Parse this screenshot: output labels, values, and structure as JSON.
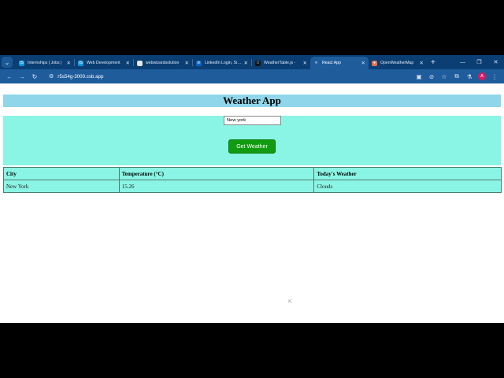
{
  "browser": {
    "tabs": [
      {
        "title": "Internships | Jobs |",
        "icon": "internshala-icon",
        "color": "#1295d8",
        "glyph": "IS"
      },
      {
        "title": "Web Development",
        "icon": "internshala-icon",
        "color": "#1295d8",
        "glyph": "IS"
      },
      {
        "title": "webwizardsolution",
        "icon": "globe-icon",
        "color": "#e0e0e0",
        "glyph": "◎"
      },
      {
        "title": "LinkedIn Login, Sign",
        "icon": "linkedin-icon",
        "color": "#0a66c2",
        "glyph": "in"
      },
      {
        "title": "WeatherTable.js - ",
        "icon": "codesandbox-icon",
        "color": "#151515",
        "glyph": "□"
      },
      {
        "title": "React App",
        "icon": "react-icon",
        "color": "#1f5c9c",
        "glyph": "⚛"
      },
      {
        "title": "OpenWeatherMap",
        "icon": "openweathermap-icon",
        "color": "#eb6e4b",
        "glyph": "●"
      }
    ],
    "active_tab_index": 5,
    "url": "r5s54g-3000.csb.app",
    "profile_initial": "A"
  },
  "page": {
    "heading": "Weather App",
    "city_input_value": "New york",
    "get_weather_label": "Get Weather",
    "table": {
      "headers": [
        "City",
        "Temperature (°C)",
        "Today's Weather"
      ],
      "rows": [
        [
          "New York",
          "15.26",
          "Clouds"
        ]
      ]
    }
  },
  "colors": {
    "tab_strip": "#0b3f74",
    "toolbar": "#1f5c9c",
    "header_bg": "#8fd6ea",
    "form_bg": "#8af5e4",
    "button_bg": "#109b10"
  }
}
